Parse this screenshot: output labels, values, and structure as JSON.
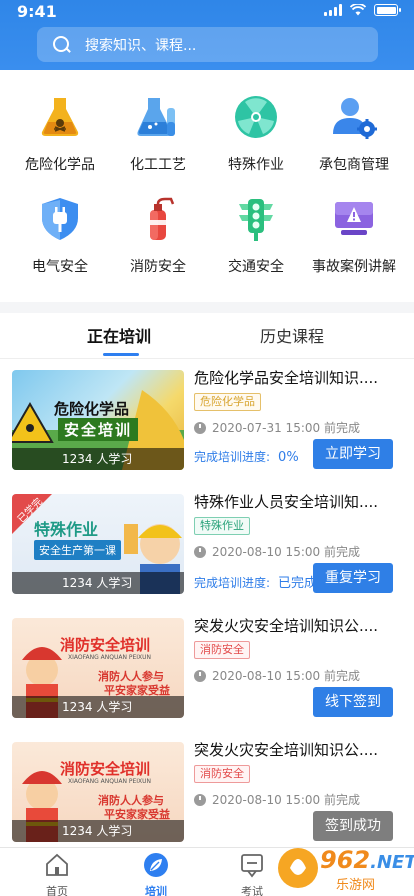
{
  "status_bar": {
    "time": "9:41"
  },
  "search": {
    "placeholder": "搜索知识、课程..."
  },
  "categories": [
    {
      "label": "危险化学品",
      "icon": "hazard-flask-icon"
    },
    {
      "label": "化工工艺",
      "icon": "chem-flask-icon"
    },
    {
      "label": "特殊作业",
      "icon": "radiation-icon"
    },
    {
      "label": "承包商管理",
      "icon": "contractor-gear-icon"
    },
    {
      "label": "电气安全",
      "icon": "electric-plug-icon"
    },
    {
      "label": "消防安全",
      "icon": "fire-extinguisher-icon"
    },
    {
      "label": "交通安全",
      "icon": "traffic-light-icon"
    },
    {
      "label": "事故案例讲解",
      "icon": "warning-monitor-icon"
    }
  ],
  "tabs": {
    "current": "正在培训",
    "history": "历史课程"
  },
  "courses": [
    {
      "title": "危险化学品安全培训知识....",
      "tag": "危险化学品",
      "date": "2020-07-31 15:00 前完成",
      "progress_label": "完成培训进度:",
      "progress_value": "0%",
      "learners": "1234 人学习",
      "button": "立即学习",
      "thumb_title_1": "危险化学品",
      "thumb_title_2": "安全培训"
    },
    {
      "title": "特殊作业人员安全培训知....",
      "tag": "特殊作业",
      "date": "2020-08-10 15:00 前完成",
      "progress_label": "完成培训进度:",
      "progress_value": "已完成",
      "learners": "1234 人学习",
      "button": "重复学习",
      "ribbon": "已学完",
      "thumb_title_1": "特殊作业",
      "thumb_title_2": "安全生产第一课"
    },
    {
      "title": "突发火灾安全培训知识公....",
      "tag": "消防安全",
      "date": "2020-08-10 15:00 前完成",
      "learners": "1234 人学习",
      "button": "线下签到",
      "thumb_title_1": "消防安全培训",
      "thumb_sub": "XIAOFANG ANQUAN PEIXUN",
      "thumb_slogan_1": "消防人人参与",
      "thumb_slogan_2": "平安家家受益"
    },
    {
      "title": "突发火灾安全培训知识公....",
      "tag": "消防安全",
      "date": "2020-08-10 15:00 前完成",
      "learners": "1234 人学习",
      "button": "签到成功",
      "thumb_title_1": "消防安全培训",
      "thumb_sub": "XIAOFANG ANQUAN PEIXUN",
      "thumb_slogan_1": "消防人人参与",
      "thumb_slogan_2": "平安家家受益"
    }
  ],
  "tabbar": [
    {
      "label": "首页",
      "icon": "home-icon"
    },
    {
      "label": "培训",
      "icon": "training-leaf-icon"
    },
    {
      "label": "考试",
      "icon": "exam-icon"
    }
  ],
  "watermark": {
    "brand": "962",
    "suffix": ".NET",
    "sub": "乐游网"
  },
  "colors": {
    "primary": "#2f7fe6",
    "header": "#3a8eee"
  }
}
